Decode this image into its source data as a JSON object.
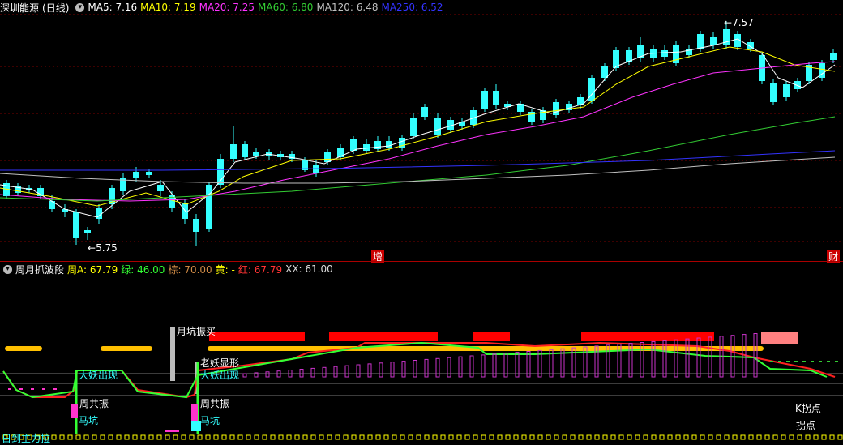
{
  "main": {
    "symbol": "深圳能源",
    "period": "(日线)",
    "ma": [
      {
        "label": "MA5: 7.16",
        "color": "#ffffff"
      },
      {
        "label": "MA10: 7.19",
        "color": "#ffff00"
      },
      {
        "label": "MA20: 7.25",
        "color": "#ff33ff"
      },
      {
        "label": "MA60: 6.80",
        "color": "#33cc33"
      },
      {
        "label": "MA120: 6.48",
        "color": "#c0c0c0"
      },
      {
        "label": "MA250: 6.52",
        "color": "#3333ff"
      }
    ],
    "high_label": "7.57",
    "low_label": "5.75",
    "marker_zeng": "增",
    "marker_cai": "财"
  },
  "sub": {
    "indicator": "周月抓波段",
    "values": [
      {
        "label": "周A: 67.79",
        "color": "#ffff00"
      },
      {
        "label": "绿: 46.00",
        "color": "#33ff33"
      },
      {
        "label": "棕: 70.00",
        "color": "#cc8844"
      },
      {
        "label": "黄: -",
        "color": "#ffff00"
      },
      {
        "label": "红: 67.79",
        "color": "#ff3333"
      },
      {
        "label": "XX: 61.00",
        "color": "#dddddd"
      }
    ],
    "annotations": {
      "yuekeng": "月坑振买",
      "dayao1": "大妖出现",
      "dayao2": "大妖出现",
      "laoyao": "老妖显形",
      "zhougongzhen1": "周共振",
      "zhougongzhen2": "周共振",
      "mk1": "马坑",
      "mk2": "马坑",
      "kguaidian": "K拐点",
      "guaidian": "拐点",
      "bottom": "日到主力拉"
    }
  },
  "colors": {
    "up": "#ff3333",
    "down": "#33ffff",
    "grid": "#7a0000"
  }
}
